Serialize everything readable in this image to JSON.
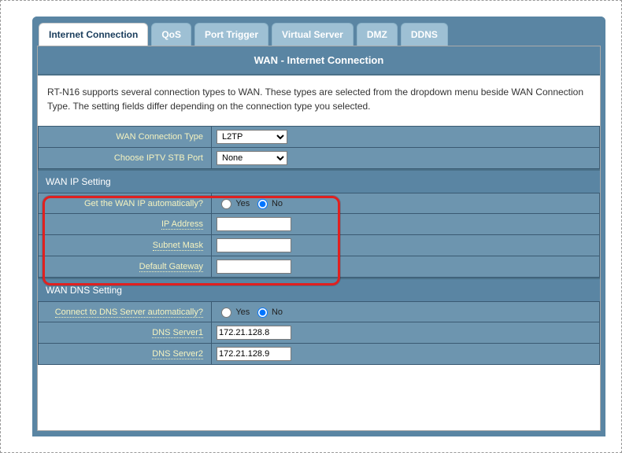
{
  "tabs": {
    "internet_connection": "Internet Connection",
    "qos": "QoS",
    "port_trigger": "Port Trigger",
    "virtual_server": "Virtual Server",
    "dmz": "DMZ",
    "ddns": "DDNS"
  },
  "page_title": "WAN - Internet Connection",
  "description": "RT-N16 supports several connection types to WAN. These types are selected from the dropdown menu beside WAN Connection Type. The setting fields differ depending on the connection type you selected.",
  "basic": {
    "wan_conn_type_label": "WAN Connection Type",
    "wan_conn_type_value": "L2TP",
    "iptv_stb_label": "Choose IPTV STB Port",
    "iptv_stb_value": "None"
  },
  "wan_ip": {
    "section_title": "WAN IP Setting",
    "auto_label": "Get the WAN IP automatically?",
    "yes_label": "Yes",
    "no_label": "No",
    "auto_selected": "no",
    "ip_address_label": "IP Address",
    "ip_address_value": "",
    "subnet_label": "Subnet Mask",
    "subnet_value": "",
    "gateway_label": "Default Gateway",
    "gateway_value": ""
  },
  "wan_dns": {
    "section_title": "WAN DNS Setting",
    "auto_label": "Connect to DNS Server automatically?",
    "yes_label": "Yes",
    "no_label": "No",
    "auto_selected": "no",
    "dns1_label": "DNS Server1",
    "dns1_value": "172.21.128.8",
    "dns2_label": "DNS Server2",
    "dns2_value": "172.21.128.9"
  }
}
